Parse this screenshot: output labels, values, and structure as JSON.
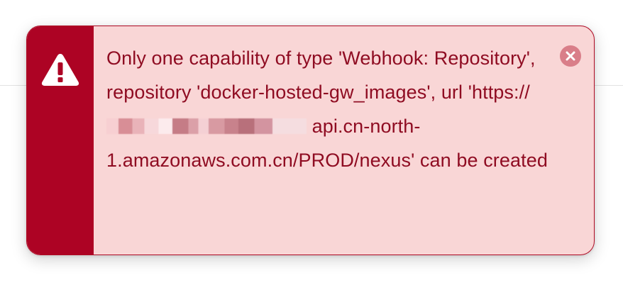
{
  "toast": {
    "severity": "error",
    "icon": "warning-icon",
    "close_icon": "close-icon",
    "message_parts": {
      "before_redaction": "Only one capability of type 'Webhook: Repository', repository 'docker-hosted-gw_images', url 'https://",
      "after_redaction": "api.cn-north-1.amazonaws.com.cn/PROD/nexus' can be created"
    },
    "colors": {
      "strip": "#ad0324",
      "background": "#f9d6d6",
      "text": "#8f0c22",
      "close": "#d97e89"
    }
  }
}
